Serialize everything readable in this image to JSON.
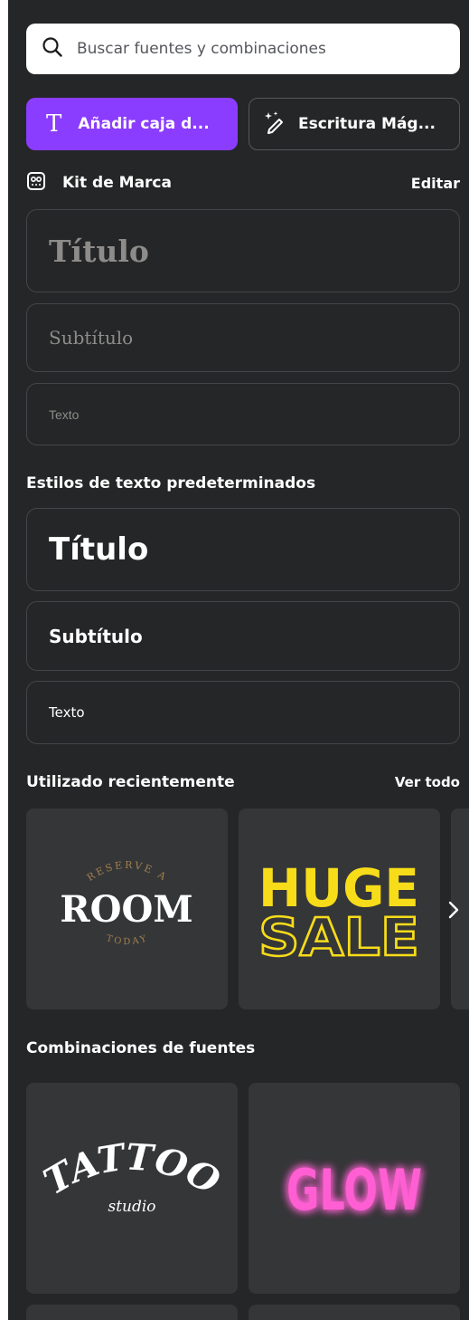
{
  "search": {
    "placeholder": "Buscar fuentes y combinaciones"
  },
  "actions": {
    "add_text_label": "Añadir caja d...",
    "add_text_icon": "T",
    "magic_write_label": "Escritura Mág..."
  },
  "brand_kit": {
    "title": "Kit de Marca",
    "edit_label": "Editar",
    "styles": {
      "heading": "Título",
      "subheading": "Subtítulo",
      "body": "Texto"
    }
  },
  "default_styles": {
    "title": "Estilos de texto predeterminados",
    "heading": "Título",
    "subheading": "Subtítulo",
    "body": "Texto"
  },
  "recent": {
    "title": "Utilizado recientemente",
    "see_all_label": "Ver todo",
    "items": [
      {
        "name": "reserve-a-room",
        "top_text": "RESERVE A",
        "main_text": "ROOM",
        "bottom_text": "TODAY"
      },
      {
        "name": "huge-sale",
        "line1": "HUGE",
        "line2": "SALE"
      }
    ]
  },
  "combinations": {
    "title": "Combinaciones de fuentes",
    "items": [
      {
        "name": "tattoo-studio",
        "main_text": "TATTOO",
        "sub_text": "studio"
      },
      {
        "name": "glow",
        "main_text": "GLOW"
      }
    ]
  },
  "colors": {
    "panel_bg": "#252627",
    "accent": "#8b3dff",
    "thumb_bg": "#353638",
    "brand_text": "#8d8c8a",
    "huge_sale_yellow": "#f7dc19",
    "glow_pink": "#ff5ed2",
    "room_gold": "#a07f4e"
  },
  "icons": [
    "search-icon",
    "text-icon",
    "magic-write-icon",
    "brand-kit-icon",
    "chevron-right-icon"
  ]
}
